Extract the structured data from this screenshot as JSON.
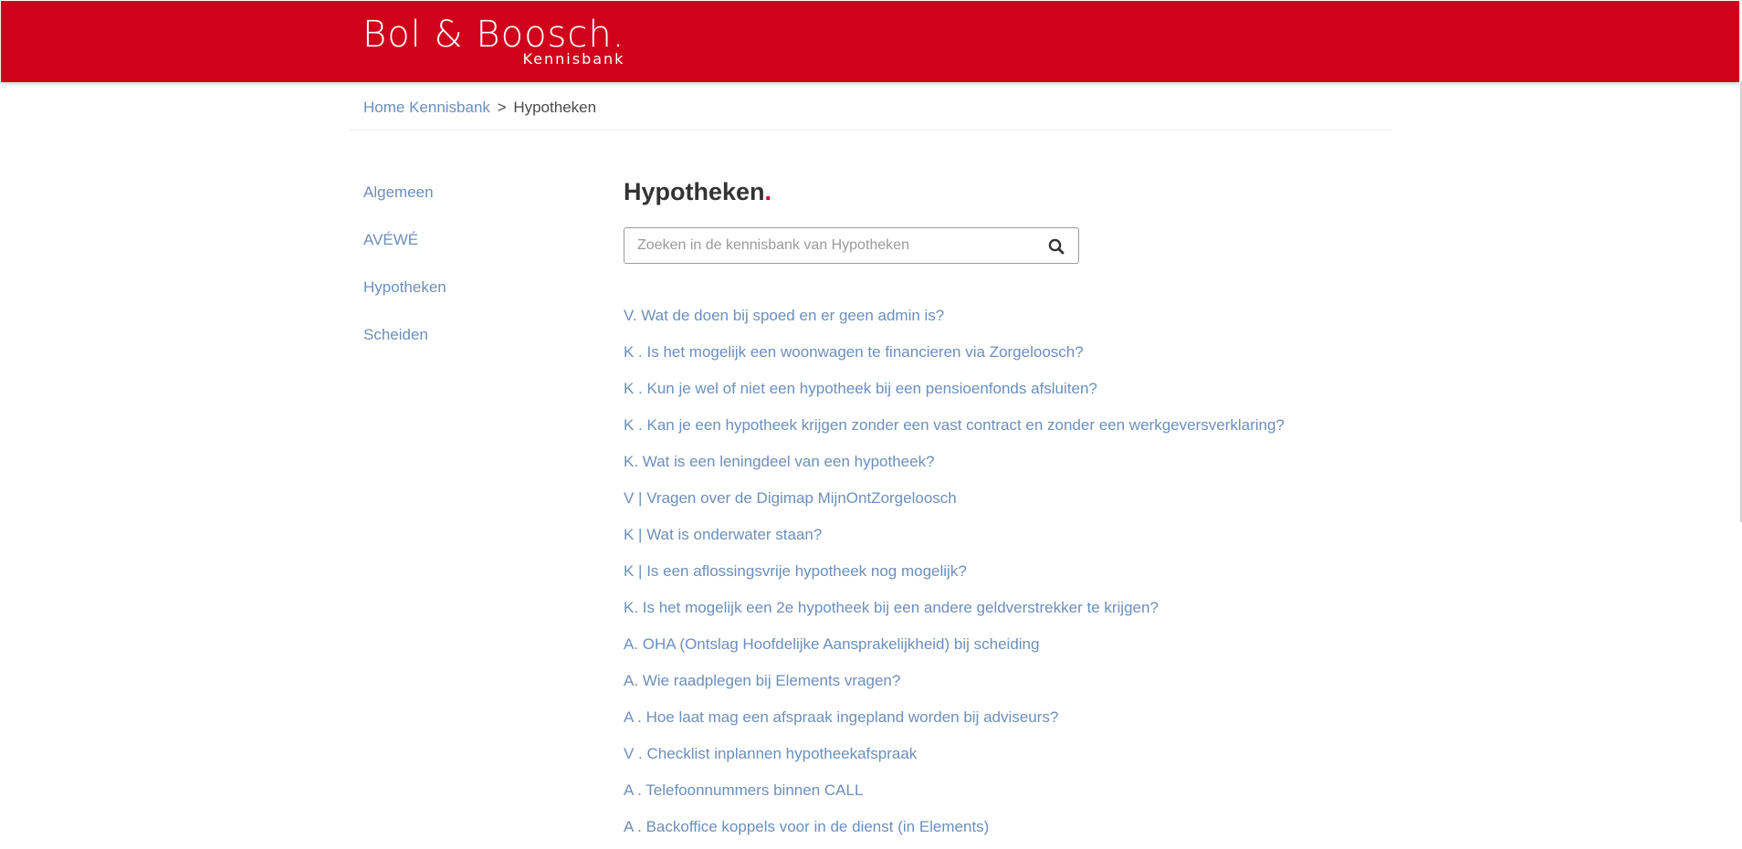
{
  "header": {
    "logo_main": "Bol & Boosch.",
    "logo_sub": "Kennisbank",
    "background_color": "#d0021b"
  },
  "breadcrumb": {
    "home_label": "Home Kennisbank",
    "separator": ">",
    "current_label": "Hypotheken"
  },
  "sidebar": {
    "items": [
      {
        "label": "Algemeen"
      },
      {
        "label": "AVÉWÉ"
      },
      {
        "label": "Hypotheken"
      },
      {
        "label": "Scheiden"
      }
    ]
  },
  "main": {
    "title": "Hypotheken",
    "title_dot": ".",
    "search": {
      "placeholder": "Zoeken in de kennisbank van Hypotheken",
      "value": "",
      "icon": "search-icon"
    },
    "articles": [
      {
        "label": "V. Wat de doen bij spoed en er geen admin is?"
      },
      {
        "label": "K . Is het mogelijk een woonwagen te financieren via Zorgeloosch?"
      },
      {
        "label": "K . Kun je wel of niet een hypotheek bij een pensioenfonds afsluiten?"
      },
      {
        "label": "K . Kan je een hypotheek krijgen zonder een vast contract en zonder een werkgeversverklaring?"
      },
      {
        "label": "K. Wat is een leningdeel van een hypotheek?"
      },
      {
        "label": "V | Vragen over de Digimap MijnOntZorgeloosch"
      },
      {
        "label": "K | Wat is onderwater staan?"
      },
      {
        "label": "K | Is een aflossingsvrije hypotheek nog mogelijk?"
      },
      {
        "label": "K. Is het mogelijk een 2e hypotheek bij een andere geldverstrekker te krijgen?"
      },
      {
        "label": "A. OHA (Ontslag Hoofdelijke Aansprakelijkheid) bij scheiding"
      },
      {
        "label": "A. Wie raadplegen bij Elements vragen?"
      },
      {
        "label": "A . Hoe laat mag een afspraak ingepland worden bij adviseurs?"
      },
      {
        "label": "V . Checklist inplannen hypotheekafspraak"
      },
      {
        "label": "A . Telefoonnummers binnen CALL"
      },
      {
        "label": "A . Backoffice koppels voor in de dienst (in Elements)"
      }
    ]
  },
  "colors": {
    "brand_red": "#d0021b",
    "link_blue": "#6b8fbd",
    "text_dark": "#333333"
  }
}
